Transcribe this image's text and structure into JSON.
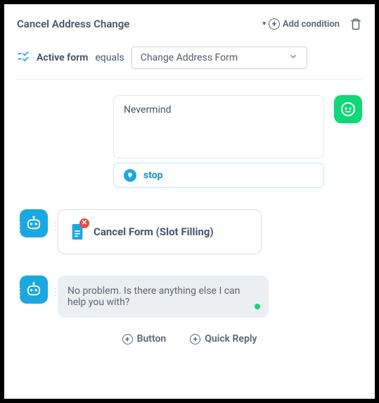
{
  "header": {
    "title": "Cancel Address Change",
    "add_condition": "Add condition"
  },
  "condition": {
    "field": "Active form",
    "operator": "equals",
    "value": "Change Address Form"
  },
  "user_turn": {
    "message": "Nevermind",
    "intent": "stop"
  },
  "action": {
    "label": "Cancel Form (Slot Filling)"
  },
  "bot_turn": {
    "message": "No problem. Is there anything else I can help you with?"
  },
  "footer": {
    "button": "Button",
    "quick_reply": "Quick Reply"
  }
}
